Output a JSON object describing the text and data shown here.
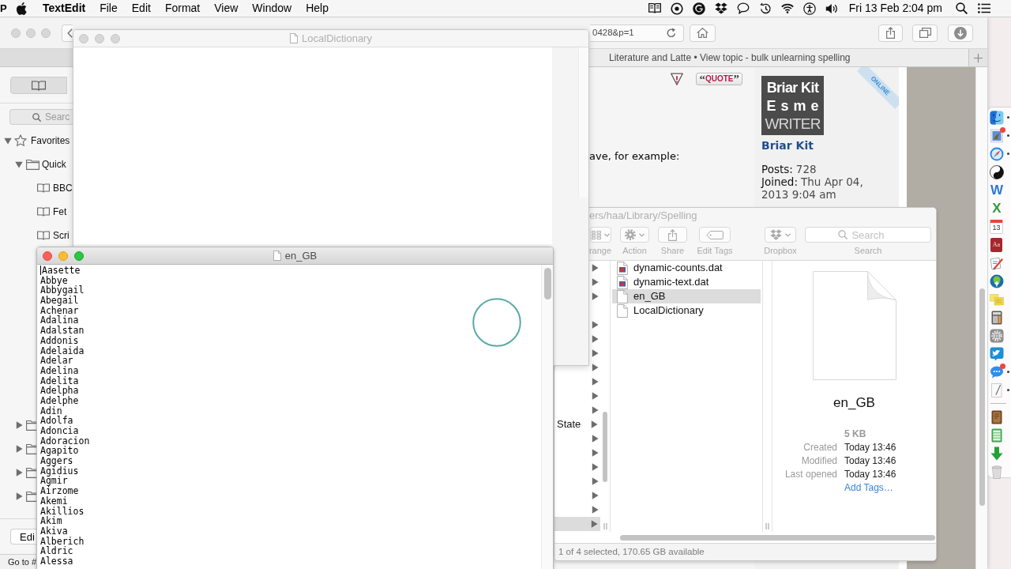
{
  "menu_bar": {
    "app_glyph": "P",
    "app_name": "TextEdit",
    "menus": [
      "File",
      "Edit",
      "Format",
      "View",
      "Window",
      "Help"
    ],
    "clock": "Fri 13 Feb 2:04 pm"
  },
  "browser": {
    "active": false,
    "address": "0428&p=1",
    "tabs": [
      {
        "title": "Literature and Latte • View topic - bulk unlearning spelling",
        "selected": true
      }
    ],
    "sidebar": {
      "modes": [
        {
          "kind": "bookmarks",
          "selected": true
        }
      ],
      "search_placeholder": "Searc",
      "tree": [
        {
          "label": "Favorites",
          "kind": "star",
          "expanded": true,
          "children": [
            {
              "label": "Quick",
              "kind": "folder",
              "expanded": true,
              "children": [
                {
                  "label": "BBC",
                  "kind": "bookmark"
                },
                {
                  "label": "Fet",
                  "kind": "bookmark"
                },
                {
                  "label": "Scri",
                  "kind": "bookmark"
                }
              ]
            },
            {
              "kind": "folder",
              "expanded": false
            },
            {
              "kind": "folder",
              "expanded": false
            },
            {
              "kind": "folder",
              "expanded": false
            },
            {
              "kind": "folder",
              "expanded": false
            }
          ]
        }
      ],
      "edit_button": "Edi",
      "link_status": "Go to #"
    },
    "page": {
      "quote_button": "“QUOTE”",
      "post_text": "ave, for example:",
      "profile": {
        "avatar_lines": [
          "Briar Kit",
          "Esme",
          "WRITER"
        ],
        "online_ribbon": "ONLINE",
        "name": "Briar Kit",
        "fields": [
          {
            "label": "Posts:",
            "value": "728"
          },
          {
            "label": "Joined:",
            "value": "Thu Apr 04, 2013 9:04 am"
          }
        ]
      }
    }
  },
  "finder": {
    "title": "ers/haa/Library/Spelling",
    "toolbar": [
      {
        "kind": "arrange",
        "label": "range"
      },
      {
        "kind": "action",
        "label": "Action"
      },
      {
        "kind": "share",
        "label": "Share"
      },
      {
        "kind": "tags",
        "label": "Edit Tags"
      },
      {
        "kind": "dropbox",
        "label": "Dropbox"
      }
    ],
    "search": {
      "placeholder": "Search",
      "label": "Search"
    },
    "parent_column": [
      {
        "kind": "folder",
        "selected": false
      },
      {
        "kind": "folder",
        "selected": false
      },
      {
        "kind": "folder",
        "selected": false
      },
      {
        "kind": "folder",
        "selected": false
      },
      {
        "kind": "folder",
        "selected": false
      },
      {
        "kind": "folder",
        "selected": false
      },
      {
        "kind": "folder",
        "selected": false
      },
      {
        "kind": "folder",
        "selected": false
      },
      {
        "kind": "folder",
        "selected": false
      },
      {
        "kind": "folder",
        "selected": false
      },
      {
        "kind": "folder",
        "label": "State",
        "selected": false
      },
      {
        "kind": "folder",
        "selected": false
      },
      {
        "kind": "folder",
        "selected": false
      },
      {
        "kind": "folder",
        "selected": false
      },
      {
        "kind": "folder",
        "selected": false
      },
      {
        "kind": "folder",
        "selected": false
      },
      {
        "kind": "folder",
        "selected": false
      },
      {
        "kind": "folder",
        "selected": true
      }
    ],
    "files": [
      {
        "name": "dynamic-counts.dat",
        "kind": "data",
        "selected": false
      },
      {
        "name": "dynamic-text.dat",
        "kind": "data",
        "selected": false
      },
      {
        "name": "en_GB",
        "kind": "document",
        "selected": true
      },
      {
        "name": "LocalDictionary",
        "kind": "document",
        "selected": false
      }
    ],
    "preview": {
      "name": "en_GB",
      "size": "5 KB",
      "details": [
        {
          "label": "Created",
          "value": "Today 13:46"
        },
        {
          "label": "Modified",
          "value": "Today 13:46"
        },
        {
          "label": "Last opened",
          "value": "Today 13:46"
        }
      ],
      "add_tags": "Add Tags…"
    },
    "status": "1 of 4 selected, 170.65 GB available"
  },
  "documents": [
    {
      "title": "LocalDictionary",
      "active": false
    },
    {
      "title": "en_GB",
      "active": true,
      "lines": [
        "Aasette",
        "Abbye",
        "Abbygail",
        "Abegail",
        "Achenar",
        "Adalina",
        "Adalstan",
        "Addonis",
        "Adelaida",
        "Adelar",
        "Adelina",
        "Adelita",
        "Adelpha",
        "Adelphe",
        "Adin",
        "Adolfa",
        "Adoncia",
        "Adoracion",
        "Agapito",
        "Aggers",
        "Agidius",
        "Agmir",
        "Airzome",
        "Akemi",
        "Akillios",
        "Akim",
        "Akiva",
        "Alberich",
        "Aldric",
        "Alessa"
      ]
    }
  ],
  "dock": {
    "apps": [
      {
        "kind": "face",
        "running": true,
        "badge": false
      },
      {
        "kind": "stamp",
        "running": true,
        "badge": true
      },
      {
        "kind": "compass",
        "running": true,
        "badge": false
      },
      {
        "kind": "yin-yang",
        "running": false,
        "badge": false
      },
      {
        "kind": "letter",
        "glyph": "W",
        "color": "#2b7bd3",
        "running": false,
        "badge": false
      },
      {
        "kind": "letter",
        "glyph": "X",
        "color": "#2f9e3c",
        "running": false,
        "badge": false
      },
      {
        "kind": "calendar",
        "glyph": "13",
        "running": false,
        "badge": false
      },
      {
        "kind": "book",
        "glyph": "Aa",
        "running": false,
        "badge": false
      },
      {
        "kind": "pencil",
        "running": false,
        "badge": false
      },
      {
        "kind": "tree",
        "running": false,
        "badge": false
      },
      {
        "kind": "notes",
        "running": false,
        "badge": false
      },
      {
        "kind": "calculator",
        "running": false,
        "badge": false
      },
      {
        "kind": "gear",
        "running": false,
        "badge": false
      },
      {
        "kind": "bird",
        "running": false,
        "badge": false
      },
      {
        "kind": "chat",
        "running": true,
        "badge": true
      },
      {
        "kind": "notepad",
        "running": true,
        "badge": false
      }
    ],
    "others": [
      {
        "kind": "case"
      },
      {
        "kind": "ledger"
      },
      {
        "kind": "arrow"
      },
      {
        "kind": "trash"
      }
    ]
  }
}
